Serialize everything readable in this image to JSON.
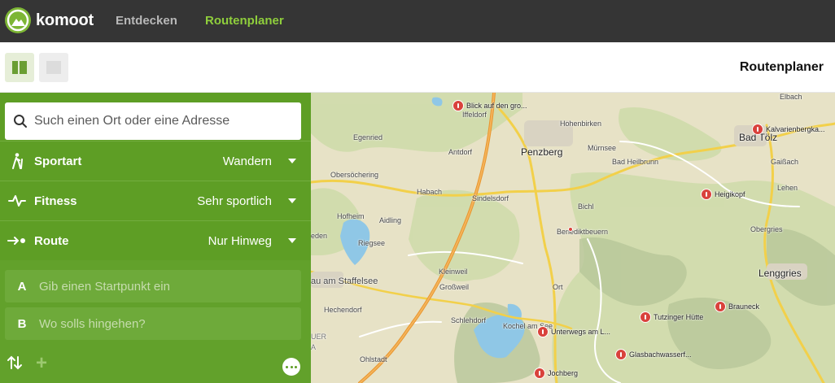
{
  "header": {
    "brand": "komoot",
    "nav": [
      "Entdecken",
      "Routenplaner"
    ]
  },
  "subbar": {
    "title": "Routenplaner"
  },
  "planner": {
    "search_placeholder": "Such einen Ort oder eine Adresse",
    "options": [
      {
        "icon": "hiker-icon",
        "label": "Sportart",
        "value": "Wandern"
      },
      {
        "icon": "pulse-icon",
        "label": "Fitness",
        "value": "Sehr sportlich"
      },
      {
        "icon": "route-arrow-icon",
        "label": "Route",
        "value": "Nur Hinweg"
      }
    ],
    "waypoints": [
      {
        "letter": "A",
        "placeholder": "Gib einen Startpunkt ein"
      },
      {
        "letter": "B",
        "placeholder": "Wo solls hingehen?"
      }
    ],
    "add_symbol": "+"
  },
  "map": {
    "towns": [
      "Penzberg",
      "Bad Tölz",
      "Lenggries"
    ],
    "places": [
      "Elbach",
      "Iffeldorf",
      "Hohenbirken",
      "Egenried",
      "Antdorf",
      "Mürnsee",
      "Bad Heilbrunn",
      "Gaißach",
      "Obersöchering",
      "Habach",
      "Sindelsdorf",
      "Lehen",
      "Bichl",
      "Hofheim",
      "Aidling",
      "Obergries",
      "eden",
      "Riegsee",
      "Benediktbeuern",
      "Kleinweil",
      "Großweil",
      "Ort",
      "au am Staffelsee",
      "Hechendorf",
      "Schlehdorf",
      "Kochel am See",
      "Ohlstadt",
      "UER",
      "A"
    ],
    "pois": [
      "Blick auf den gro...",
      "Kalvarienbergka...",
      "Heigikopf",
      "Tutzinger Hütte",
      "Brauneck",
      "Unterwegs am L...",
      "Glasbachwasserf...",
      "Jochberg"
    ]
  }
}
